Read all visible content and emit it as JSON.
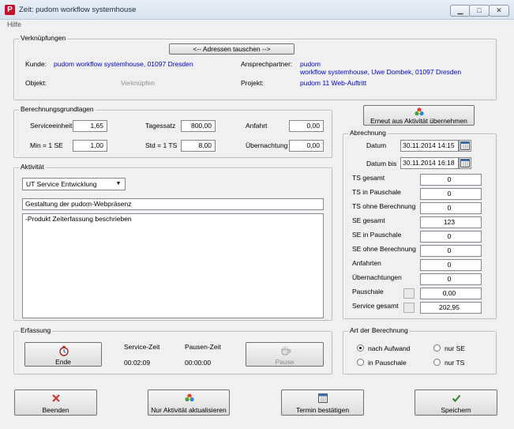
{
  "window": {
    "title": "Zeit: pudom  workflow systemhouse",
    "app_icon_letter": "P",
    "minimize": "▁",
    "maximize": "□",
    "close": "✕"
  },
  "menu": {
    "help": "Hilfe"
  },
  "links": {
    "legend": "Verknüpfungen",
    "swap_button": "<-- Adressen tauschen -->",
    "kunde_label": "Kunde:",
    "kunde_value": "pudom workflow systemhouse, 01097 Dresden",
    "objekt_label": "Objekt:",
    "objekt_value": "Verknüpfen",
    "ansprechpartner_label": "Ansprechpartner:",
    "ansprechpartner_line1": "pudom",
    "ansprechpartner_line2": "workflow systemhouse, Uwe Dombek, 01097 Dresden",
    "projekt_label": "Projekt:",
    "projekt_value": "pudom 11 Web-Auftritt"
  },
  "basis": {
    "legend": "Berechnungsgrundlagen",
    "serviceeinheit_label": "Serviceeinheit",
    "serviceeinheit_value": "1,65",
    "min_se_label": "Min = 1 SE",
    "min_se_value": "1,00",
    "tagessatz_label": "Tagessatz",
    "tagessatz_value": "800,00",
    "std_ts_label": "Std = 1 TS",
    "std_ts_value": "8,00",
    "anfahrt_label": "Anfahrt",
    "anfahrt_value": "0,00",
    "uebernachtung_label": "Übernachtung",
    "uebernachtung_value": "0,00"
  },
  "reapply_button": "Erneut aus Aktivität übernehmen",
  "activity": {
    "legend": "Aktivität",
    "selected": "UT  Service Entwicklung",
    "title_value": "Gestaltung der pudom-Webpräsenz",
    "text_value": "-Produkt Zeiterfassung beschrieben"
  },
  "abrechnung": {
    "legend": "Abrechnung",
    "datum_label": "Datum",
    "datum_value": "30.11.2014 14:15",
    "datum_bis_label": "Datum bis",
    "datum_bis_value": "30.11.2014 16:18",
    "rows": [
      {
        "label": "TS gesamt",
        "value": "0"
      },
      {
        "label": "TS in Pauschale",
        "value": "0"
      },
      {
        "label": "TS ohne Berechnung",
        "value": "0"
      },
      {
        "label": "SE gesamt",
        "value": "123"
      },
      {
        "label": "SE in Pauschale",
        "value": "0"
      },
      {
        "label": "SE ohne Berechnung",
        "value": "0"
      },
      {
        "label": "Anfahrten",
        "value": "0"
      },
      {
        "label": "Übernachtungen",
        "value": "0"
      },
      {
        "label": "Pauschale",
        "value": "0,00"
      },
      {
        "label": "Service gesamt",
        "value": "202,95"
      }
    ]
  },
  "erfassung": {
    "legend": "Erfassung",
    "ende_button": "Ende",
    "service_zeit_label": "Service-Zeit",
    "service_zeit_value": "00:02:09",
    "pausen_zeit_label": "Pausen-Zeit",
    "pausen_zeit_value": "00:00:00",
    "pause_button": "Pause"
  },
  "berechnungsart": {
    "legend": "Art der Berechnung",
    "options": [
      {
        "label": "nach Aufwand",
        "selected": true
      },
      {
        "label": "nur SE",
        "selected": false
      },
      {
        "label": "in Pauschale",
        "selected": false
      },
      {
        "label": "nur TS",
        "selected": false
      }
    ]
  },
  "footer": {
    "beenden": "Beenden",
    "nur_aktualisieren": "Nur Aktivität aktualisieren",
    "termin_bestaetigen": "Termin bestätigen",
    "speichern": "Speichern"
  },
  "colors": {
    "link_blue": "#0000d6",
    "disabled_grey": "#8f8f8f",
    "title_bar": "#dbe5f1"
  }
}
